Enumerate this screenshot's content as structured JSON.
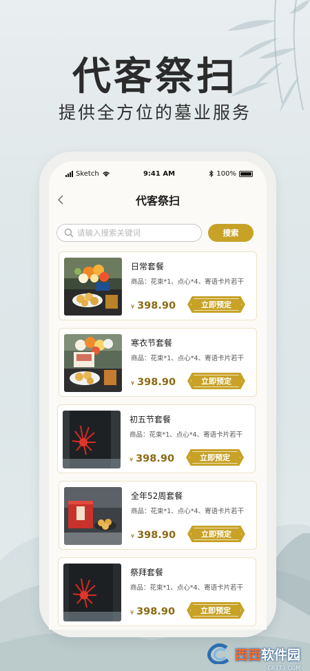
{
  "hero": {
    "title": "代客祭扫",
    "subtitle": "提供全方位的墓业服务"
  },
  "status_bar": {
    "carrier": "Sketch",
    "time": "9:41 AM",
    "battery": "100%",
    "icons": [
      "signal-bars-icon",
      "wifi-icon",
      "bluetooth-icon",
      "battery-icon"
    ]
  },
  "nav": {
    "title": "代客祭扫",
    "back_icon": "chevron-left-icon"
  },
  "search": {
    "placeholder": "请输入搜索关键词",
    "button_label": "搜索"
  },
  "packages": [
    {
      "name": "日常套餐",
      "desc": "商品：花束*1、点心*4、寄语卡片若干",
      "currency": "¥",
      "price": "398.90",
      "button": "立即预定",
      "image": "flowers-pastries"
    },
    {
      "name": "寒衣节套餐",
      "desc": "商品：花束*1、点心*4、寄语卡片若干",
      "currency": "¥",
      "price": "398.90",
      "button": "立即预定",
      "image": "flowers-pastries-tea"
    },
    {
      "name": "初五节套餐",
      "desc": "商品：花束*1、点心*4、寄语卡片若干",
      "currency": "¥",
      "price": "398.90",
      "button": "立即预定",
      "image": "red-flower-tombstone"
    },
    {
      "name": "全年52周套餐",
      "desc": "商品：花束*1、点心*4、寄语卡片若干",
      "currency": "¥",
      "price": "398.90",
      "button": "立即预定",
      "image": "gift-box"
    },
    {
      "name": "祭拜套餐",
      "desc": "商品：花束*1、点心*4、寄语卡片若干",
      "currency": "¥",
      "price": "398.90",
      "button": "立即预定",
      "image": "red-flower-tombstone"
    }
  ],
  "watermark": {
    "brand_a": "西西",
    "brand_b": "软件园",
    "url": "CR173.COM"
  },
  "colors": {
    "accent_gold": "#c7a227",
    "price_gold": "#8b6a13",
    "card_border": "#ebe2c6"
  }
}
